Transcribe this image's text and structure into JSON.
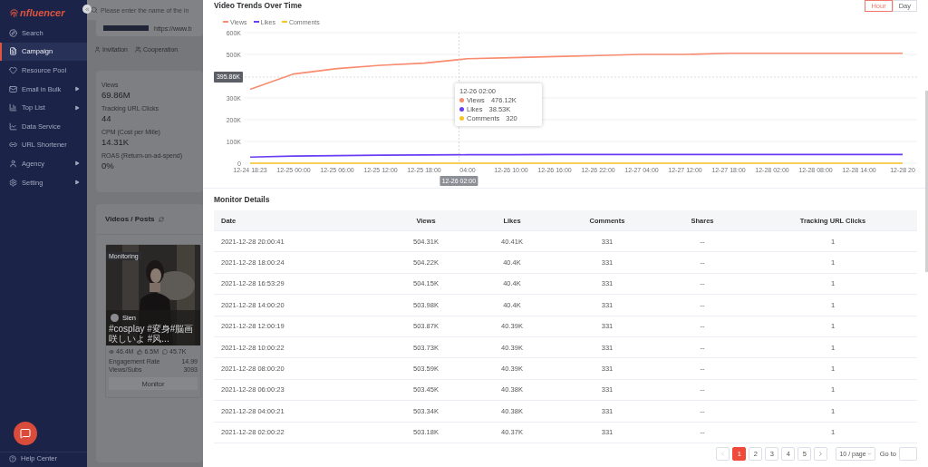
{
  "sidebar": {
    "logo": "nfluencer",
    "items": [
      {
        "label": "Search",
        "selected": false,
        "submenu": false
      },
      {
        "label": "Campaign",
        "selected": true,
        "submenu": false
      },
      {
        "label": "Resource Pool",
        "selected": false,
        "submenu": false
      },
      {
        "label": "Email in Bulk",
        "selected": false,
        "submenu": true
      },
      {
        "label": "Top List",
        "selected": false,
        "submenu": true
      },
      {
        "label": "Data Service",
        "selected": false,
        "submenu": false
      },
      {
        "label": "URL Shortener",
        "selected": false,
        "submenu": false
      },
      {
        "label": "Agency",
        "selected": false,
        "submenu": true
      },
      {
        "label": "Setting",
        "selected": false,
        "submenu": true
      }
    ],
    "help": "Help Center"
  },
  "background_page": {
    "search": {
      "placeholder": "Please enter the name of the in"
    },
    "url": "https://www.b",
    "tabs": [
      {
        "label": "Invitation"
      },
      {
        "label": "Cooperation"
      }
    ],
    "stats": [
      {
        "label": "Views",
        "value": "69.86M"
      },
      {
        "label": "Tracking URL Clicks",
        "value": "44"
      },
      {
        "label": "CPM (Cost per Mille)",
        "value": "14.31K"
      },
      {
        "label": "ROAS (Return-on-ad-spend)",
        "value": "0%"
      }
    ],
    "videos": {
      "title": "Videos / Posts",
      "card": {
        "kind": "picture",
        "badge": "Monitoring",
        "author": "Sien",
        "caption": "#cosplay #変身#脳画咲しいよ #风...",
        "views": "46.4M",
        "likes": "6.5M",
        "comments": "45.7K",
        "metrics": [
          {
            "label": "Engagement Rate",
            "value": "14.99"
          },
          {
            "label": "Views/Subs",
            "value": "3093"
          }
        ],
        "button": "Monitor"
      }
    }
  },
  "drawer": {
    "trends": {
      "title": "Video Trends Over Time",
      "toggle": [
        {
          "label": "Hour",
          "selected": true
        },
        {
          "label": "Day",
          "selected": false
        }
      ],
      "pointer_x_label": "12-26 02:00",
      "tooltip": {
        "title": "12-26 02:00",
        "rows": [
          {
            "name": "Views",
            "value": "476.12K",
            "color": "#f98b6f"
          },
          {
            "name": "Likes",
            "value": "38.53K",
            "color": "#6a3df5"
          },
          {
            "name": "Comments",
            "value": "320",
            "color": "#f7c325"
          }
        ]
      },
      "chart_data": {
        "type": "line",
        "categories": [
          "12-24 18:23",
          "12-25 00:00",
          "12-25 06:00",
          "12-25 12:00",
          "12-25 18:00",
          "04:00",
          "12-26 10:00",
          "12-26 16:00",
          "12-26 22:00",
          "12-27 04:00",
          "12-27 12:00",
          "12-27 18:00",
          "12-28 02:00",
          "12-28 08:00",
          "12-28 14:00",
          "12-28 20"
        ],
        "series": [
          {
            "name": "Views",
            "color": "#f98b6f",
            "values": [
              340000,
              410000,
              435000,
              450000,
              460000,
              480000,
              485000,
              490000,
              495000,
              500000,
              500000,
              505000,
              505000,
              505000,
              505000,
              505000
            ]
          },
          {
            "name": "Likes",
            "color": "#6a3df5",
            "values": [
              28000,
              33000,
              35000,
              37000,
              38000,
              39000,
              39000,
              40000,
              40000,
              40000,
              40000,
              40000,
              40000,
              40000,
              40000,
              40000
            ]
          },
          {
            "name": "Comments",
            "color": "#f7c325",
            "values": [
              0,
              0,
              0,
              0,
              0,
              0,
              0,
              0,
              0,
              0,
              0,
              0,
              0,
              0,
              0,
              0
            ]
          }
        ],
        "grid": true,
        "ref_lines": [
          {
            "axis": "y",
            "value": 395860,
            "label": "395.86K"
          }
        ],
        "ylim": [
          0,
          600000
        ],
        "yticks": [
          {
            "value": 0,
            "label": "0"
          },
          {
            "value": 100000,
            "label": "100K"
          },
          {
            "value": 200000,
            "label": "200K"
          },
          {
            "value": 300000,
            "label": "300K"
          },
          {
            "value": 500000,
            "label": "500K"
          },
          {
            "value": 600000,
            "label": "600K"
          }
        ]
      }
    },
    "monitor_details": {
      "title": "Monitor Details",
      "columns": [
        "Date",
        "Views",
        "Likes",
        "Comments",
        "Shares",
        "Tracking URL Clicks"
      ],
      "rows": [
        [
          "2021-12-28 20:00:41",
          "504.31K",
          "40.41K",
          "331",
          "--",
          "1"
        ],
        [
          "2021-12-28 18:00:24",
          "504.22K",
          "40.4K",
          "331",
          "--",
          "1"
        ],
        [
          "2021-12-28 16:53:29",
          "504.15K",
          "40.4K",
          "331",
          "--",
          "1"
        ],
        [
          "2021-12-28 14:00:20",
          "503.98K",
          "40.4K",
          "331",
          "--",
          "1"
        ],
        [
          "2021-12-28 12:00:19",
          "503.87K",
          "40.39K",
          "331",
          "--",
          "1"
        ],
        [
          "2021-12-28 10:00:22",
          "503.73K",
          "40.39K",
          "331",
          "--",
          "1"
        ],
        [
          "2021-12-28 08:00:20",
          "503.59K",
          "40.39K",
          "331",
          "--",
          "1"
        ],
        [
          "2021-12-28 06:00:23",
          "503.45K",
          "40.38K",
          "331",
          "--",
          "1"
        ],
        [
          "2021-12-28 04:00:21",
          "503.34K",
          "40.38K",
          "331",
          "--",
          "1"
        ],
        [
          "2021-12-28 02:00:22",
          "503.18K",
          "40.37K",
          "331",
          "--",
          "1"
        ]
      ]
    },
    "pagination": {
      "pages": [
        {
          "label": "1",
          "selected": true
        },
        {
          "label": "2",
          "selected": false
        },
        {
          "label": "3",
          "selected": false
        },
        {
          "label": "4",
          "selected": false
        },
        {
          "label": "5",
          "selected": false
        }
      ],
      "page_size": "10 / page",
      "goto": "Go to"
    }
  }
}
